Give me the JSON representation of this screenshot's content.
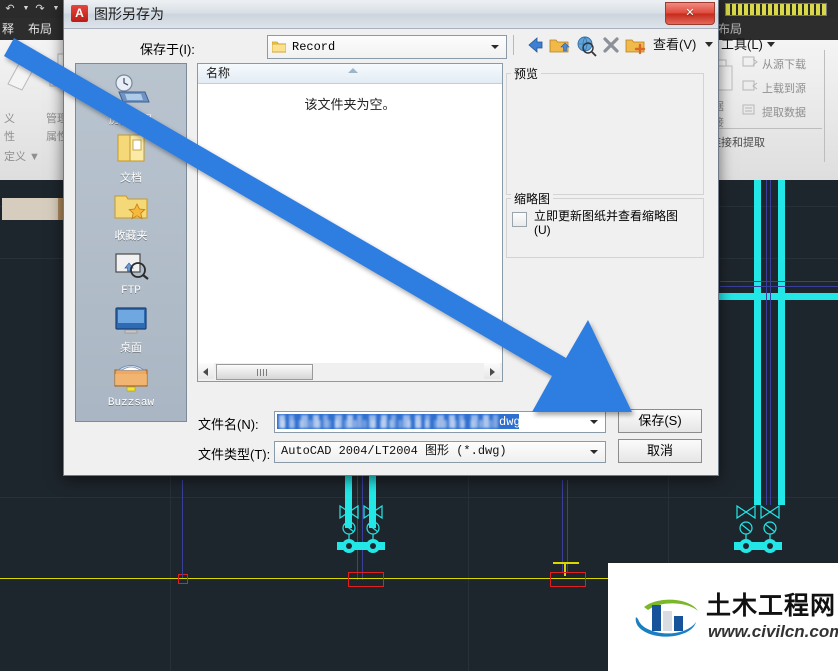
{
  "app": {
    "quick_access_icons": [
      "undo-icon",
      "redo-icon"
    ],
    "tabs": [
      {
        "label": "释",
        "name": "tab-annotate"
      },
      {
        "label": "布局",
        "name": "tab-layout"
      }
    ],
    "ribbon_left": {
      "items": [
        {
          "label": "义",
          "name": "ribbon-item-define"
        },
        {
          "label": "管理",
          "name": "ribbon-item-manage"
        },
        {
          "label": "性",
          "name": "ribbon-item-property-a"
        },
        {
          "label": "属性",
          "name": "ribbon-item-property-b"
        },
        {
          "label": "定义 ▼",
          "name": "ribbon-item-definition-dropdown"
        }
      ]
    },
    "ribbon_right": {
      "items": [
        {
          "label": "从源下载",
          "name": "ribbon-item-download-from-source"
        },
        {
          "label": "上载到源",
          "name": "ribbon-item-upload-to-source"
        },
        {
          "label": "提取数据",
          "name": "ribbon-item-extract-data"
        }
      ],
      "side_labels": [
        "数据",
        "链接"
      ],
      "panel_title": "链接和提取"
    }
  },
  "dialog": {
    "title": "图形另存为",
    "title_icon": "autocad-a-icon",
    "close_label": "✕",
    "save_in": {
      "label": "保存于(I):",
      "value": "Record",
      "folder_icon": "folder-icon"
    },
    "toolbar": {
      "items": [
        {
          "name": "back-icon",
          "kind": "icon"
        },
        {
          "name": "up-one-level-icon",
          "kind": "icon"
        },
        {
          "name": "search-web-icon",
          "kind": "icon"
        },
        {
          "name": "delete-icon",
          "kind": "icon"
        },
        {
          "name": "new-folder-icon",
          "kind": "icon"
        },
        {
          "name": "view-menu",
          "kind": "menu",
          "label": "查看(V)"
        },
        {
          "name": "tools-menu",
          "kind": "menu",
          "label": "工具(L)"
        }
      ]
    },
    "places": [
      {
        "label": "历史记录",
        "icon": "history-icon",
        "name": "place-history"
      },
      {
        "label": "文档",
        "icon": "documents-icon",
        "name": "place-documents"
      },
      {
        "label": "收藏夹",
        "icon": "favorites-icon",
        "name": "place-favorites"
      },
      {
        "label": "FTP",
        "icon": "ftp-icon",
        "name": "place-ftp"
      },
      {
        "label": "桌面",
        "icon": "desktop-icon",
        "name": "place-desktop"
      },
      {
        "label": "Buzzsaw",
        "icon": "buzzsaw-icon",
        "name": "place-buzzsaw"
      }
    ],
    "file_list": {
      "column_header": "名称",
      "empty_message": "该文件夹为空。",
      "sort_icon": "sort-ascending-icon"
    },
    "preview": {
      "group_title": "预览"
    },
    "thumbnail": {
      "group_title": "缩略图",
      "checkbox_label": "立即更新图纸并查看缩略图(U)",
      "checked": false
    },
    "file_name": {
      "label": "文件名(N):",
      "value": ".dwg",
      "value_extension": "dwg",
      "selected": true,
      "obscured": true
    },
    "file_type": {
      "label": "文件类型(T):",
      "value": "AutoCAD 2004/LT2004 图形 (*.dwg)"
    },
    "buttons": {
      "save": "保存(S)",
      "cancel": "取消"
    }
  },
  "annotation": {
    "arrow_color": "#2f7de0",
    "arrow_name": "blue-pointer-arrow",
    "points_to": "保存(S)"
  },
  "watermark": {
    "site_name": "土木工程网",
    "url": "www.civilcn.com",
    "logo_icon": "civilcn-building-logo"
  },
  "colors": {
    "cad_background": "#1e262d",
    "pipe_cyan": "#23e7e7",
    "centerline_yellow": "#d8d800",
    "outline_red": "#e02020",
    "thin_blue": "#3a3f9c",
    "dialog_face": "#f0f0f0",
    "selection_blue": "#2f6fd0"
  }
}
